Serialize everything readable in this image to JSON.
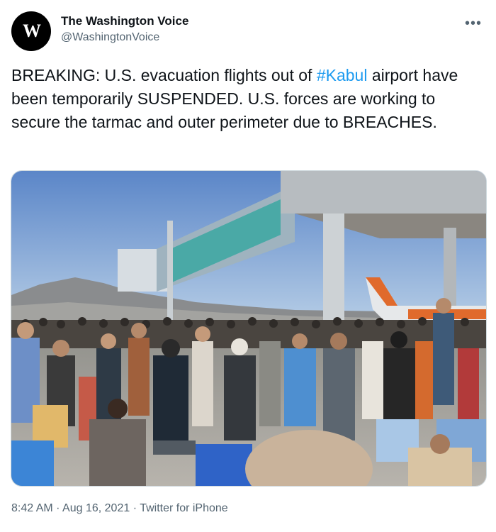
{
  "account": {
    "display_name": "The Washington Voice",
    "handle": "@WashingtonVoice",
    "avatar_letter": "W"
  },
  "tweet": {
    "text_before": "BREAKING: U.S. evacuation flights out of ",
    "hashtag": "#Kabul",
    "text_after": " airport have been temporarily SUSPENDED. U.S. forces are working to secure the tarmac and outer perimeter due to BREACHES."
  },
  "meta": {
    "time": "8:42 AM",
    "separator": " · ",
    "date": "Aug 16, 2021",
    "source": "Twitter for iPhone"
  },
  "icons": {
    "more": "more-options-icon"
  },
  "colors": {
    "link": "#1d9bf0",
    "secondary_text": "#536471",
    "primary_text": "#0f1419"
  }
}
